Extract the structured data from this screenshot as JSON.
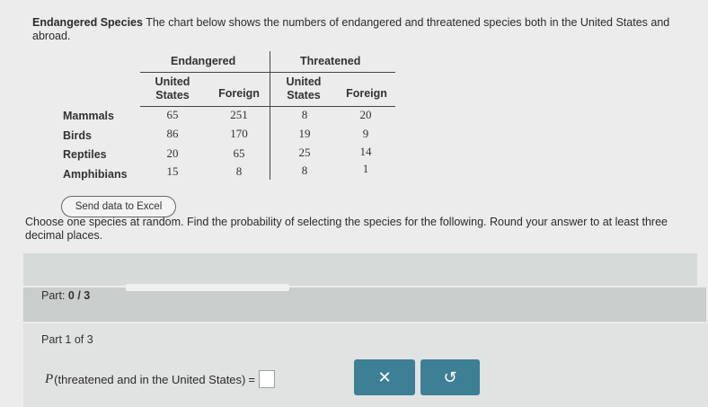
{
  "intro": {
    "title": "Endangered Species",
    "text": "The chart below shows the numbers of endangered and threatened species both in the United States and abroad."
  },
  "table": {
    "groups": [
      "Endangered",
      "Threatened"
    ],
    "column_headers": [
      "United States",
      "Foreign",
      "United States",
      "Foreign"
    ],
    "rows": [
      {
        "label": "Mammals",
        "values": [
          "65",
          "251",
          "8",
          "20"
        ]
      },
      {
        "label": "Birds",
        "values": [
          "86",
          "170",
          "19",
          "9"
        ]
      },
      {
        "label": "Reptiles",
        "values": [
          "20",
          "65",
          "25",
          "14"
        ]
      },
      {
        "label": "Amphibians",
        "values": [
          "15",
          "8",
          "8",
          "1"
        ]
      }
    ]
  },
  "excel_button": "Send data to Excel",
  "question": "Choose one species at random. Find the probability of selecting the species for the following. Round your answer to at least three decimal places.",
  "part_progress": {
    "label": "Part:",
    "value": "0 / 3",
    "fraction": 0.0
  },
  "part_current": "Part 1 of 3",
  "expression": {
    "p": "P",
    "text": "(threatened and in the United States)",
    "equals": "="
  },
  "buttons": {
    "clear": "✕",
    "undo": "↺"
  }
}
